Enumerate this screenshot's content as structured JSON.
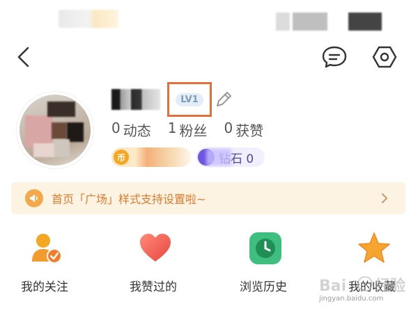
{
  "header": {
    "back_icon": "back-chevron-icon",
    "message_icon": "message-icon",
    "settings_icon": "settings-hexagon-icon"
  },
  "profile": {
    "level": "LV1",
    "stats": [
      {
        "count": "0",
        "label": "动态"
      },
      {
        "count": "1",
        "label": "粉丝"
      },
      {
        "count": "0",
        "label": "获赞"
      }
    ],
    "coin_icon_text": "币",
    "diamond_label": "钻石 0"
  },
  "notice": {
    "text": "首页「广场」样式支持设置啦~"
  },
  "shortcuts": [
    {
      "label": "我的关注",
      "icon": "follow-person-icon"
    },
    {
      "label": "我赞过的",
      "icon": "heart-icon"
    },
    {
      "label": "浏览历史",
      "icon": "clock-history-icon"
    },
    {
      "label": "我的收藏",
      "icon": "star-icon"
    }
  ],
  "colors": {
    "accent_orange": "#e07b2c",
    "level_border": "#e46f3b",
    "notice_bg": "#fdf3e3"
  }
}
